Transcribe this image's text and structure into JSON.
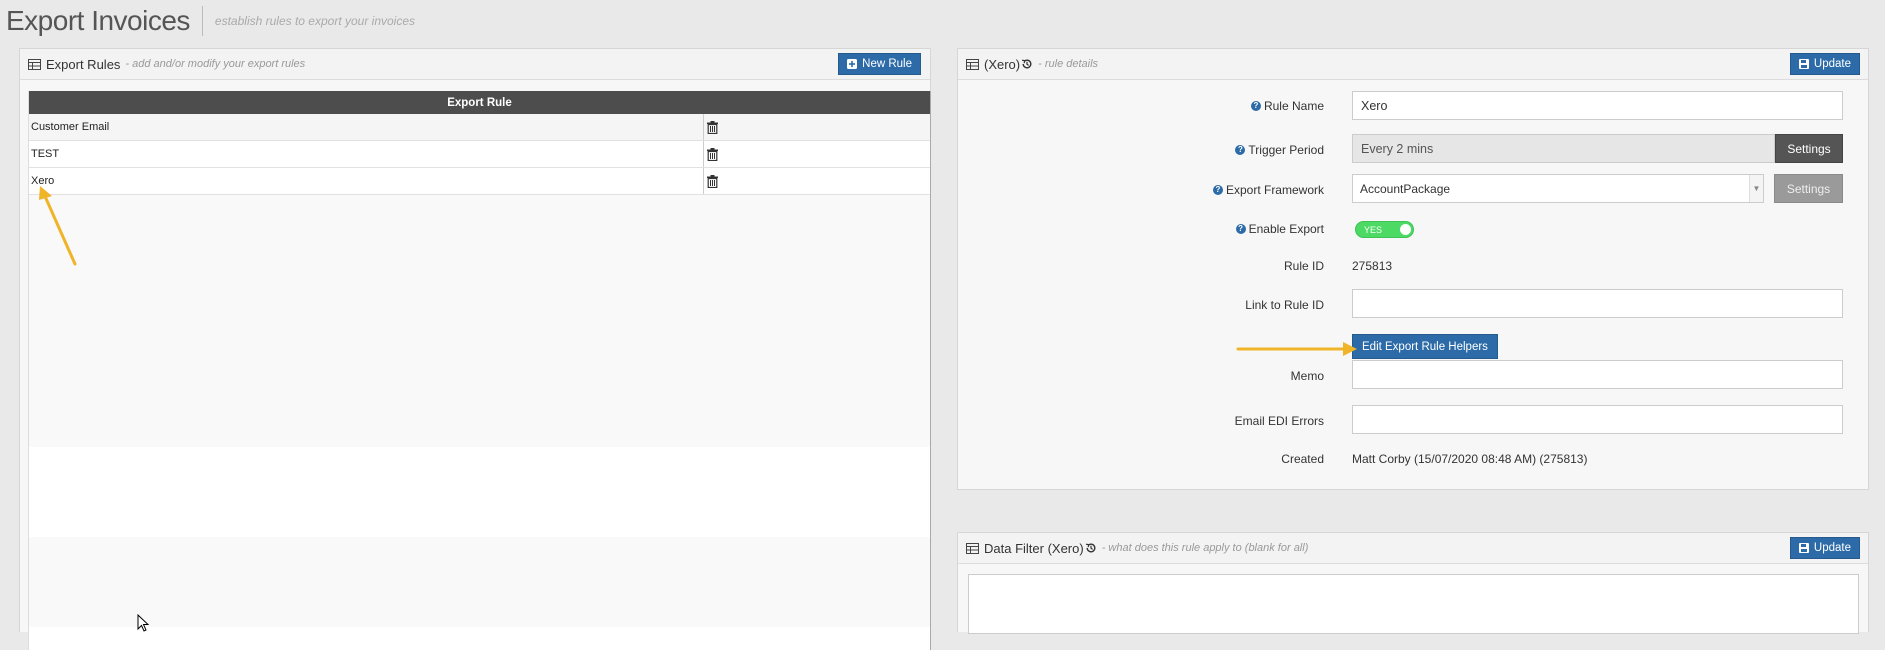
{
  "page": {
    "title": "Export Invoices",
    "subtitle": "establish rules to export your invoices"
  },
  "rules_panel": {
    "title": "Export Rules",
    "subtitle": "- add and/or modify your export rules",
    "new_button": "New Rule",
    "column_header": "Export Rule",
    "rows": [
      {
        "name": "Customer Email"
      },
      {
        "name": "TEST"
      },
      {
        "name": "Xero"
      }
    ]
  },
  "detail_panel": {
    "title": "(Xero)",
    "subtitle": "- rule details",
    "update_button": "Update",
    "fields": {
      "rule_name_label": "Rule Name",
      "rule_name_value": "Xero",
      "trigger_label": "Trigger Period",
      "trigger_value": "Every 2 mins",
      "trigger_settings": "Settings",
      "framework_label": "Export Framework",
      "framework_value": "AccountPackage",
      "framework_settings": "Settings",
      "enable_label": "Enable Export",
      "enable_value": "YES",
      "rule_id_label": "Rule ID",
      "rule_id_value": "275813",
      "link_label": "Link to Rule ID",
      "link_value": "",
      "helpers_button": "Edit Export Rule Helpers",
      "memo_label": "Memo",
      "memo_value": "",
      "email_errors_label": "Email EDI Errors",
      "email_errors_value": "",
      "created_label": "Created",
      "created_value": "Matt Corby (15/07/2020 08:48 AM) (275813)"
    }
  },
  "filter_panel": {
    "title": "Data Filter (Xero)",
    "subtitle": "- what does this rule apply to (blank for all)",
    "update_button": "Update"
  },
  "colors": {
    "primary": "#2c6ba8",
    "header_dark": "#4d4d4d",
    "toggle_on": "#4cd964",
    "annotation_arrow": "#f0b428"
  }
}
